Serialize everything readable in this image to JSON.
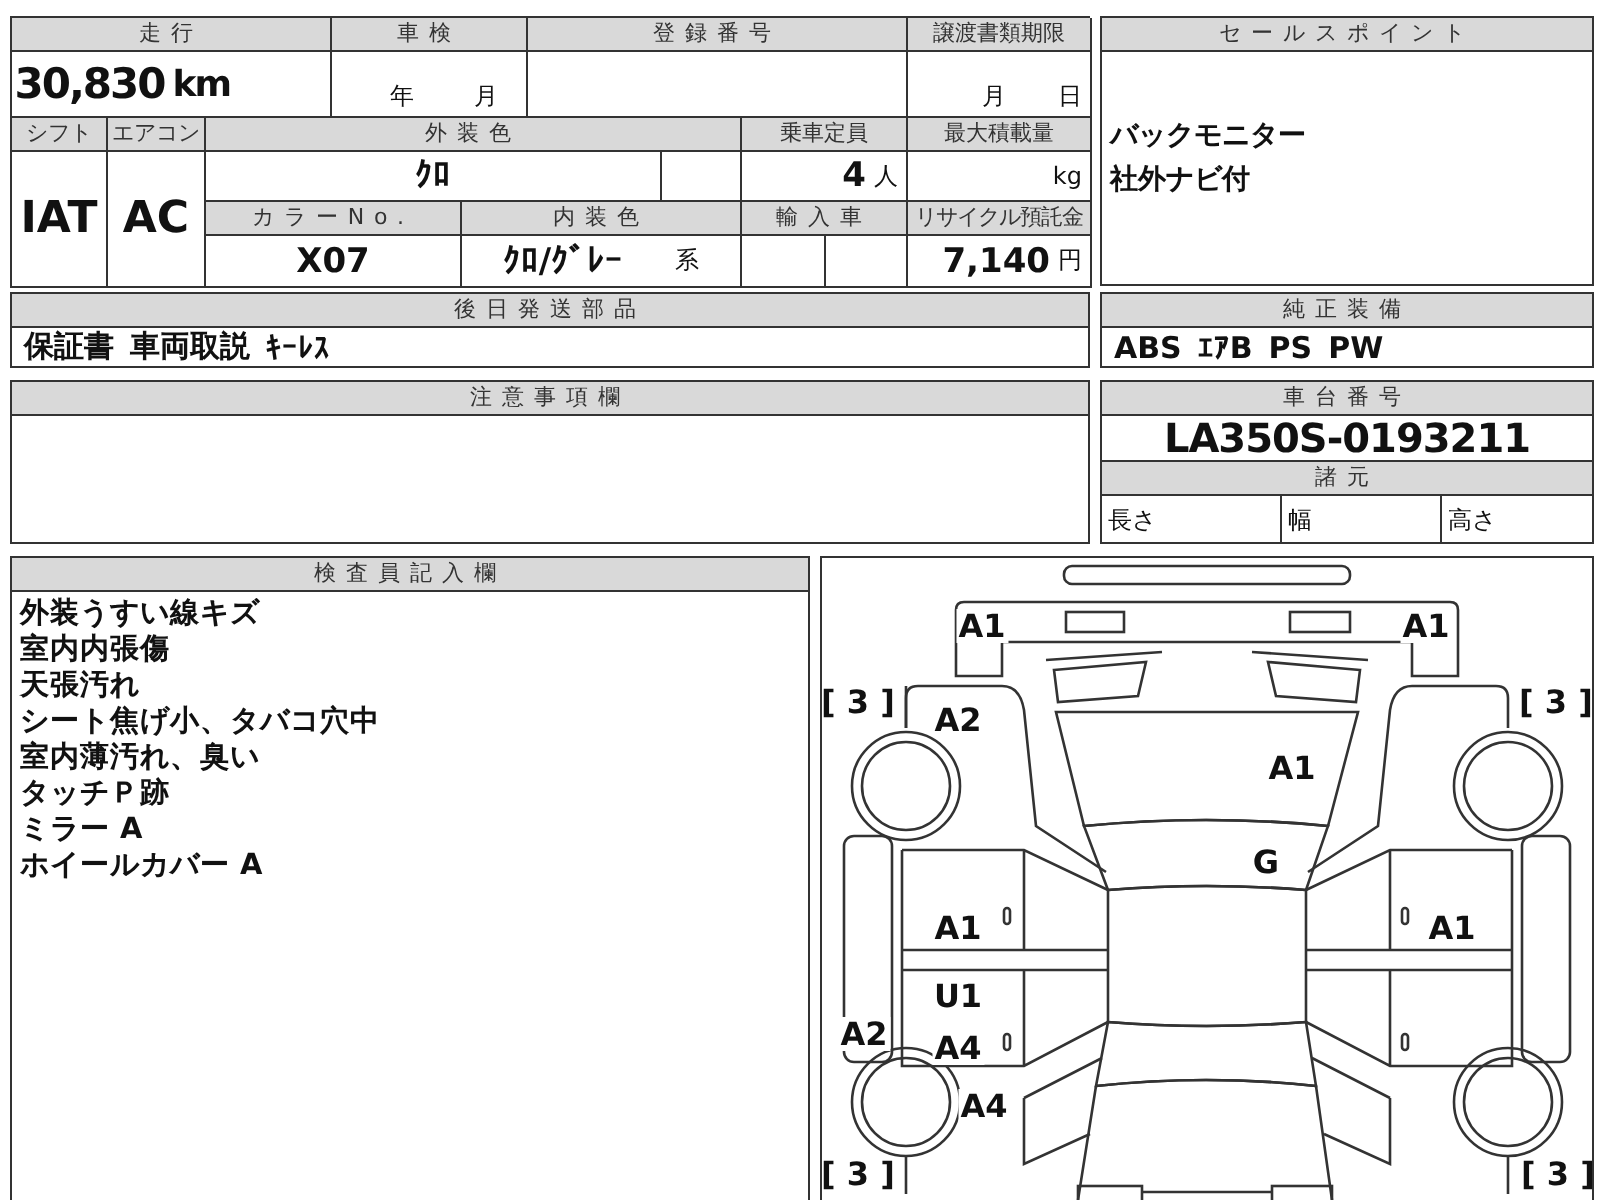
{
  "mileage": {
    "label": "走行",
    "value": "30,830",
    "unit": "km"
  },
  "inspection": {
    "label": "車検",
    "year_unit": "年",
    "month_unit": "月"
  },
  "registration_number": {
    "label": "登録番号"
  },
  "transfer_deadline": {
    "label": "譲渡書類期限",
    "month_unit": "月",
    "day_unit": "日"
  },
  "shift": {
    "label": "シフト",
    "value": "IAT"
  },
  "air_conditioner": {
    "label": "エアコン",
    "value": "AC"
  },
  "exterior_color": {
    "label": "外装色",
    "value": "ｸﾛ"
  },
  "capacity": {
    "label": "乗車定員",
    "value": "4",
    "unit": "人"
  },
  "max_load": {
    "label": "最大積載量",
    "unit": "kg"
  },
  "color_no": {
    "label": "カラーNo.",
    "value": "X07"
  },
  "interior_color": {
    "label": "内装色",
    "value": "ｸﾛ/ｸﾞﾚｰ",
    "suffix": "系"
  },
  "imported": {
    "label": "輸入車"
  },
  "recycle_fee": {
    "label": "リサイクル預託金",
    "value": "7,140",
    "unit": "円"
  },
  "sales_points": {
    "label": "セールスポイント",
    "lines": [
      "バックモニター",
      "社外ナビ付"
    ]
  },
  "later_shipped_parts": {
    "label": "後日発送部品",
    "items": [
      "保証書",
      "車両取説",
      "ｷｰﾚｽ"
    ]
  },
  "standard_equipment": {
    "label": "純正装備",
    "items": [
      "ABS",
      "ｴｱB",
      "PS",
      "PW"
    ]
  },
  "notes": {
    "label": "注意事項欄"
  },
  "chassis_number": {
    "label": "車台番号",
    "value": "LA350S-0193211"
  },
  "specifications": {
    "label": "諸元",
    "fields": [
      "長さ",
      "幅",
      "高さ"
    ]
  },
  "inspector_notes": {
    "label": "検査員記入欄",
    "lines": [
      "外装うすい線キズ",
      "室内内張傷",
      "天張汚れ",
      "シート焦げ小、タバコ穴中",
      "室内薄汚れ、臭い",
      "タッチＰ跡",
      "ミラー A",
      "ホイールカバー A"
    ]
  },
  "damage_diagram": {
    "marks": [
      "A1",
      "A1",
      "[ 3 ]",
      "[ 3 ]",
      "A2",
      "A1",
      "G",
      "A1",
      "A1",
      "U1",
      "A2",
      "A4",
      "A4",
      "[ 3 ]",
      "[ 3 ]"
    ]
  }
}
